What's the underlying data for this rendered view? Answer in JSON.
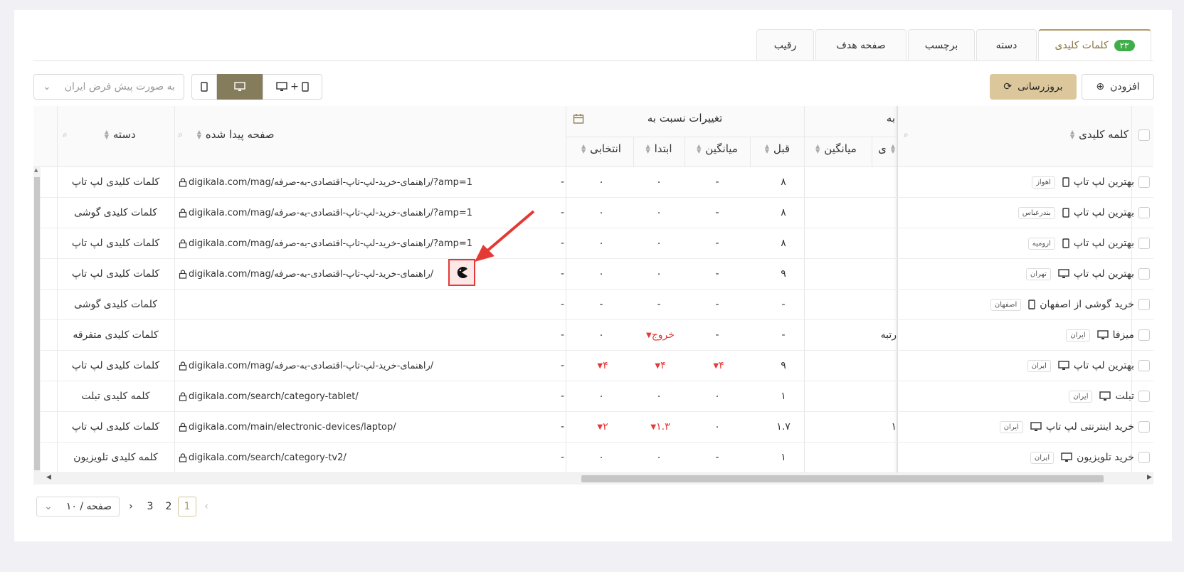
{
  "tabs": [
    {
      "label": "کلمات کلیدی",
      "count": "۲۳",
      "active": true
    },
    {
      "label": "دسته"
    },
    {
      "label": "برچسب"
    },
    {
      "label": "صفحه هدف"
    },
    {
      "label": "رقیب"
    }
  ],
  "toolbar": {
    "add_label": "افزودن",
    "refresh_label": "بروزرسانی",
    "device_combo_plus": "+",
    "region_placeholder": "به صورت پیش فرض ایران"
  },
  "header": {
    "keyword": "کلمه کلیدی",
    "rank_partial": "به",
    "rank_partial2": "ی",
    "avg": "میانگین",
    "changes_group": "تغییرات نسبت به",
    "prev": "قبل",
    "avg2": "میانگین",
    "start": "ابتدا",
    "selected": "انتخابی",
    "found_page": "صفحه پیدا شده",
    "category": "دسته"
  },
  "rows": [
    {
      "keyword": "بهترین لپ تاپ",
      "device": "mobile",
      "location": "اهواز",
      "rank_partial": "",
      "avg": "۸",
      "prev": "-",
      "avg_change": "۰",
      "start": "۰",
      "selected": "-",
      "url": "digikala.com/mag/راهنمای-خرید-لپ-تاپ-اقتصادی-به-صرفه/?amp=1",
      "category": "کلمات کلیدی لپ تاپ"
    },
    {
      "keyword": "بهترین لپ تاپ",
      "device": "mobile",
      "location": "بندرعباس",
      "rank_partial": "",
      "avg": "۸",
      "prev": "-",
      "avg_change": "۰",
      "start": "۰",
      "selected": "-",
      "url": "digikala.com/mag/راهنمای-خرید-لپ-تاپ-اقتصادی-به-صرفه/?amp=1",
      "category": "کلمات کلیدی گوشی"
    },
    {
      "keyword": "بهترین لپ تاپ",
      "device": "mobile",
      "location": "ارومیه",
      "rank_partial": "",
      "avg": "۸",
      "prev": "-",
      "avg_change": "۰",
      "start": "۰",
      "selected": "-",
      "url": "digikala.com/mag/راهنمای-خرید-لپ-تاپ-اقتصادی-به-صرفه/?amp=1",
      "category": "کلمات کلیدی لپ تاپ"
    },
    {
      "keyword": "بهترین لپ تاپ",
      "device": "desktop",
      "location": "تهران",
      "rank_partial": "",
      "avg": "۹",
      "prev": "-",
      "avg_change": "۰",
      "start": "۰",
      "selected": "-",
      "url": "digikala.com/mag/راهنمای-خرید-لپ-تاپ-اقتصادی-به-صرفه/",
      "category": "کلمات کلیدی لپ تاپ"
    },
    {
      "keyword": "خرید گوشی از اصفهان",
      "device": "mobile",
      "location": "اصفهان",
      "rank_partial": "",
      "avg": "-",
      "prev": "-",
      "avg_change": "-",
      "start": "-",
      "selected": "-",
      "url": "",
      "category": "کلمات کلیدی گوشی"
    },
    {
      "keyword": "میزفا",
      "device": "desktop",
      "location": "ایران",
      "rank_partial": "رتبه",
      "avg": "-",
      "prev": "-",
      "avg_change": "خروج",
      "start": "۰",
      "selected": "-",
      "url": "",
      "category": "کلمات کلیدی متفرقه"
    },
    {
      "keyword": "بهترین لپ تاپ",
      "device": "desktop",
      "location": "ایران",
      "rank_partial": "",
      "avg": "۹",
      "prev": "۴",
      "avg_change": "۴",
      "start": "۴",
      "selected": "-",
      "url": "digikala.com/mag/راهنمای-خرید-لپ-تاپ-اقتصادی-به-صرفه/",
      "category": "کلمات کلیدی لپ تاپ"
    },
    {
      "keyword": "تبلت",
      "device": "desktop",
      "location": "ایران",
      "rank_partial": "",
      "avg": "۱",
      "prev": "۰",
      "avg_change": "۰",
      "start": "۰",
      "selected": "-",
      "url": "digikala.com/search/category-tablet/",
      "category": "کلمه کلیدی تبلت"
    },
    {
      "keyword": "خرید اینترنتی لپ تاپ",
      "device": "desktop",
      "location": "ایران",
      "rank_partial": "۱",
      "avg": "۱.۷",
      "prev": "۰",
      "avg_change": "۱.۳",
      "start": "۲",
      "selected": "-",
      "url": "digikala.com/main/electronic-devices/laptop/",
      "category": "کلمات کلیدی لپ تاپ"
    },
    {
      "keyword": "خرید تلویزیون",
      "device": "desktop",
      "location": "ایران",
      "rank_partial": "",
      "avg": "۱",
      "prev": "-",
      "avg_change": "۰",
      "start": "۰",
      "selected": "-",
      "url": "digikala.com/search/category-tv2/",
      "category": "کلمه کلیدی تلویزیون"
    }
  ],
  "pagination": {
    "pages": [
      "1",
      "2",
      "3"
    ],
    "page_size": "۱۰ / صفحه"
  },
  "colors": {
    "accent": "#b49a6a",
    "refresh": "#dbc79b",
    "active_seg": "#857c5c",
    "down": "#e53935"
  }
}
